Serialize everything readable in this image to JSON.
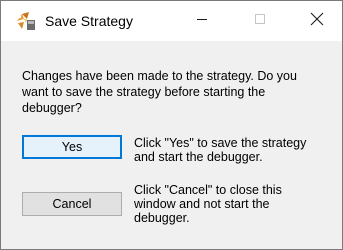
{
  "window": {
    "title": "Save Strategy",
    "icon": "strategy-app-icon",
    "controls": {
      "minimize_icon": "minimize-icon",
      "maximize_icon": "maximize-icon",
      "close_icon": "close-icon"
    }
  },
  "dialog": {
    "message_line_1": "Changes have been made to the strategy.  Do you",
    "message_line_2": "want to save the strategy before starting the",
    "message_line_3": "debugger?",
    "yes_button": {
      "label": "Yes",
      "desc_line_1": "Click \"Yes\" to save the strategy",
      "desc_line_2": "and start the debugger."
    },
    "cancel_button": {
      "label": "Cancel",
      "desc_line_1": "Click \"Cancel\" to close this",
      "desc_line_2": "window and not start the",
      "desc_line_3": "debugger."
    }
  },
  "colors": {
    "accent": "#0078d7",
    "dialog_bg": "#f0f0f0",
    "titlebar_bg": "#ffffff"
  }
}
